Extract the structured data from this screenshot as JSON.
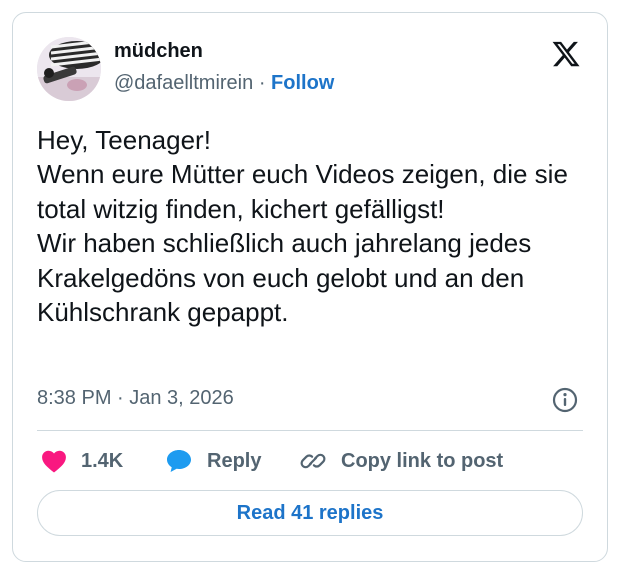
{
  "author": {
    "name": "müdchen",
    "handle": "@dafaelltmirein",
    "separator": "·",
    "follow_label": "Follow",
    "avatar_icon": "profile-photo"
  },
  "tweet": {
    "text": "Hey, Teenager!\nWenn eure Mütter euch Videos zeigen, die sie total witzig finden, kichert gefälligst!\nWir haben schließlich auch jahrelang jedes Krakelgedöns von euch gelobt und an den Kühlschrank gepappt.",
    "timestamp": "8:38 PM · Jan 3, 2026"
  },
  "actions": {
    "likes_count": "1.4K",
    "reply_label": "Reply",
    "copy_link_label": "Copy link to post",
    "read_replies_label": "Read 41 replies"
  },
  "icons": {
    "brand": "x-logo",
    "info": "info-icon",
    "like": "heart-icon",
    "reply": "speech-bubble-icon",
    "copy_link": "link-icon"
  },
  "colors": {
    "accent": "#1d74c9",
    "like": "#f91880",
    "text": "#0f1419",
    "muted": "#536471",
    "border": "#cfd9de"
  }
}
